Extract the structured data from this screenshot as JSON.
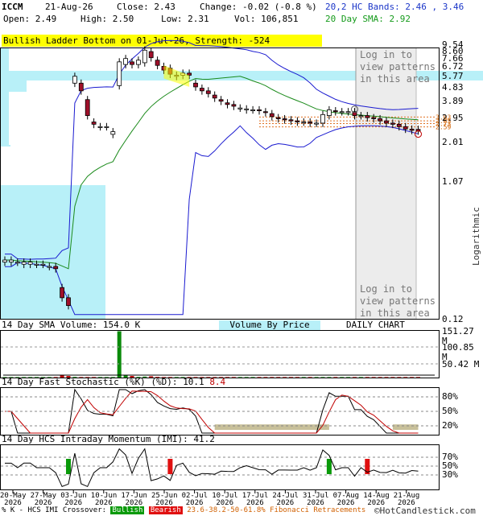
{
  "header": {
    "symbol": "ICCM",
    "date": "21-Aug-26",
    "close_label": "Close: 2.43",
    "change_label": "Change: -0.02 (-0.8 %)",
    "open_label": "Open: 2.49",
    "high_label": "High: 2.50",
    "low_label": "Low: 2.31",
    "vol_label": "Vol: 106,851",
    "bands_label": "20,2 HC Bands: 2.46 , 3.46",
    "sma_label": "20 Day SMA: 2.92"
  },
  "banner": "Bullish Ladder Bottom on 01-Jul-26, Strength: -524",
  "login_text_1": "Log in to view patterns in this area",
  "login_text_2": "Log in to view patterns in this area",
  "price_axis": {
    "ticks": [
      "9.54",
      "8.60",
      "7.66",
      "6.72",
      "5.77",
      "4.83",
      "3.89",
      "2.95",
      "2.01",
      "1.07",
      "0.12"
    ],
    "scale_label": "Logarithmic"
  },
  "volume_panel": {
    "title": "14 Day SMA Volume: 154.0 K",
    "vbp_label": "Volume By Price",
    "chart_label": "DAILY CHART",
    "ticks": [
      "151.27 M",
      "100.85 M",
      "50.42 M"
    ]
  },
  "stoch_panel": {
    "title": "14 Day Fast Stochastic (%K)",
    "d_label": "(%D):",
    "k_value": "10.1",
    "d_value": "8.4",
    "ticks": [
      "80%",
      "50%",
      "20%"
    ]
  },
  "imi_panel": {
    "title": "14 Day HCS Intraday Momentum (IMI): 41.2",
    "ticks": [
      "70%",
      "50%",
      "30%"
    ]
  },
  "x_axis": {
    "labels": [
      {
        "top": "20-May",
        "bottom": "2026"
      },
      {
        "top": "27-May",
        "bottom": "2026"
      },
      {
        "top": "03-Jun",
        "bottom": "2026"
      },
      {
        "top": "10-Jun",
        "bottom": "2026"
      },
      {
        "top": "17-Jun",
        "bottom": "2026"
      },
      {
        "top": "25-Jun",
        "bottom": "2026"
      },
      {
        "top": "02-Jul",
        "bottom": "2026"
      },
      {
        "top": "10-Jul",
        "bottom": "2026"
      },
      {
        "top": "17-Jul",
        "bottom": "2026"
      },
      {
        "top": "24-Jul",
        "bottom": "2026"
      },
      {
        "top": "31-Jul",
        "bottom": "2026"
      },
      {
        "top": "07-Aug",
        "bottom": "2026"
      },
      {
        "top": "14-Aug",
        "bottom": "2026"
      },
      {
        "top": "21-Aug",
        "bottom": "2026"
      }
    ]
  },
  "footer": {
    "prefix": "% K - HCS IMI Crossover:",
    "bullish": "Bullish",
    "bearish": "Bearish",
    "fib": "23.6-38.2-50-61.8% Fibonacci Retracements",
    "copyright": "©HotCandlestick.com"
  },
  "colors": {
    "bull_candle": "#ffffff",
    "bear_candle": "#a0102a",
    "upper_band": "#1a1ad0",
    "lower_band": "#1a1ad0",
    "sma": "#1a8a1a",
    "vbp": "#b8f0f8",
    "highlight": "#ffff00"
  },
  "chart_data": [
    {
      "type": "candlestick",
      "title": "ICCM",
      "scale": "log",
      "ylim": [
        0.12,
        9.54
      ],
      "x": [
        "20-May",
        "21-May",
        "22-May",
        "26-May",
        "27-May",
        "28-May",
        "29-May",
        "01-Jun",
        "02-Jun",
        "03-Jun",
        "04-Jun",
        "05-Jun",
        "08-Jun",
        "09-Jun",
        "10-Jun",
        "11-Jun",
        "12-Jun",
        "15-Jun",
        "16-Jun",
        "17-Jun",
        "18-Jun",
        "19-Jun",
        "22-Jun",
        "23-Jun",
        "24-Jun",
        "25-Jun",
        "26-Jun",
        "29-Jun",
        "30-Jun",
        "01-Jul",
        "02-Jul",
        "06-Jul",
        "07-Jul",
        "08-Jul",
        "09-Jul",
        "10-Jul",
        "13-Jul",
        "14-Jul",
        "15-Jul",
        "16-Jul",
        "17-Jul",
        "20-Jul",
        "21-Jul",
        "22-Jul",
        "23-Jul",
        "24-Jul",
        "27-Jul",
        "28-Jul",
        "29-Jul",
        "30-Jul",
        "31-Jul",
        "03-Aug",
        "04-Aug",
        "05-Aug",
        "06-Aug",
        "07-Aug",
        "10-Aug",
        "11-Aug",
        "12-Aug",
        "13-Aug",
        "14-Aug",
        "17-Aug",
        "18-Aug",
        "19-Aug",
        "20-Aug",
        "21-Aug"
      ],
      "open": [
        0.3,
        0.3,
        0.3,
        0.29,
        0.29,
        0.29,
        0.29,
        0.28,
        0.28,
        0.2,
        0.17,
        5.2,
        5.2,
        4.0,
        2.8,
        2.6,
        2.6,
        2.3,
        5.0,
        7.0,
        7.3,
        7.0,
        7.2,
        8.6,
        7.5,
        6.8,
        6.6,
        5.8,
        5.9,
        6.1,
        5.2,
        4.8,
        4.6,
        4.3,
        4.0,
        3.8,
        3.7,
        3.5,
        3.4,
        3.4,
        3.4,
        3.3,
        3.2,
        3.0,
        2.95,
        2.9,
        2.85,
        2.8,
        2.8,
        2.75,
        2.75,
        3.1,
        3.35,
        3.3,
        3.3,
        3.3,
        3.1,
        3.1,
        3.0,
        2.95,
        2.85,
        2.75,
        2.7,
        2.6,
        2.5,
        2.49
      ],
      "close": [
        0.31,
        0.31,
        0.3,
        0.3,
        0.3,
        0.29,
        0.29,
        0.28,
        0.27,
        0.17,
        0.15,
        5.8,
        4.6,
        3.1,
        2.7,
        2.6,
        2.6,
        2.4,
        7.3,
        7.7,
        7.0,
        7.5,
        8.8,
        7.8,
        6.9,
        6.4,
        6.0,
        5.9,
        6.1,
        5.9,
        4.9,
        4.6,
        4.4,
        4.1,
        3.9,
        3.7,
        3.6,
        3.5,
        3.45,
        3.4,
        3.35,
        3.25,
        3.05,
        2.95,
        2.9,
        2.85,
        2.8,
        2.8,
        2.75,
        2.75,
        3.15,
        3.4,
        3.3,
        3.3,
        3.3,
        3.1,
        3.1,
        3.0,
        2.95,
        2.85,
        2.75,
        2.7,
        2.6,
        2.5,
        2.45,
        2.43
      ],
      "volume_millions": [
        0.5,
        0.4,
        0.4,
        0.3,
        0.3,
        0.3,
        0.3,
        0.3,
        0.3,
        8.0,
        5.0,
        2.0,
        1.0,
        0.8,
        0.6,
        0.5,
        0.5,
        0.5,
        150.0,
        8.0,
        5.0,
        2.0,
        3.0,
        4.0,
        2.0,
        1.5,
        1.0,
        1.0,
        1.0,
        0.8,
        0.7,
        0.6,
        0.5,
        0.5,
        0.4,
        0.4,
        0.4,
        0.3,
        0.3,
        0.3,
        0.3,
        0.3,
        0.3,
        0.3,
        0.3,
        0.3,
        0.3,
        0.3,
        0.3,
        0.3,
        0.5,
        0.4,
        0.4,
        0.3,
        0.3,
        0.3,
        0.3,
        0.3,
        0.3,
        0.3,
        0.2,
        0.2,
        0.2,
        0.2,
        0.2,
        0.1
      ],
      "indicators": {
        "hc_upper_band": 3.46,
        "hc_lower_band": 2.46,
        "sma20": 2.92,
        "fibonacci_levels": [
          "3.03",
          "2.85",
          "2.73",
          "2.59"
        ]
      }
    },
    {
      "type": "bar",
      "title": "14 Day SMA Volume: 154.0 K",
      "ylabel": "Volume",
      "ylim": [
        0,
        151.27
      ]
    },
    {
      "type": "line",
      "title": "14 Day Fast Stochastic (%K) (%D): 10.1 8.4",
      "ylim": [
        0,
        100
      ],
      "series": [
        {
          "name": "%K",
          "last": 10.1
        },
        {
          "name": "%D",
          "last": 8.4
        }
      ]
    },
    {
      "type": "line",
      "title": "14 Day HCS Intraday Momentum (IMI): 41.2",
      "ylim": [
        0,
        100
      ],
      "series": [
        {
          "name": "IMI",
          "last": 41.2
        }
      ]
    }
  ]
}
